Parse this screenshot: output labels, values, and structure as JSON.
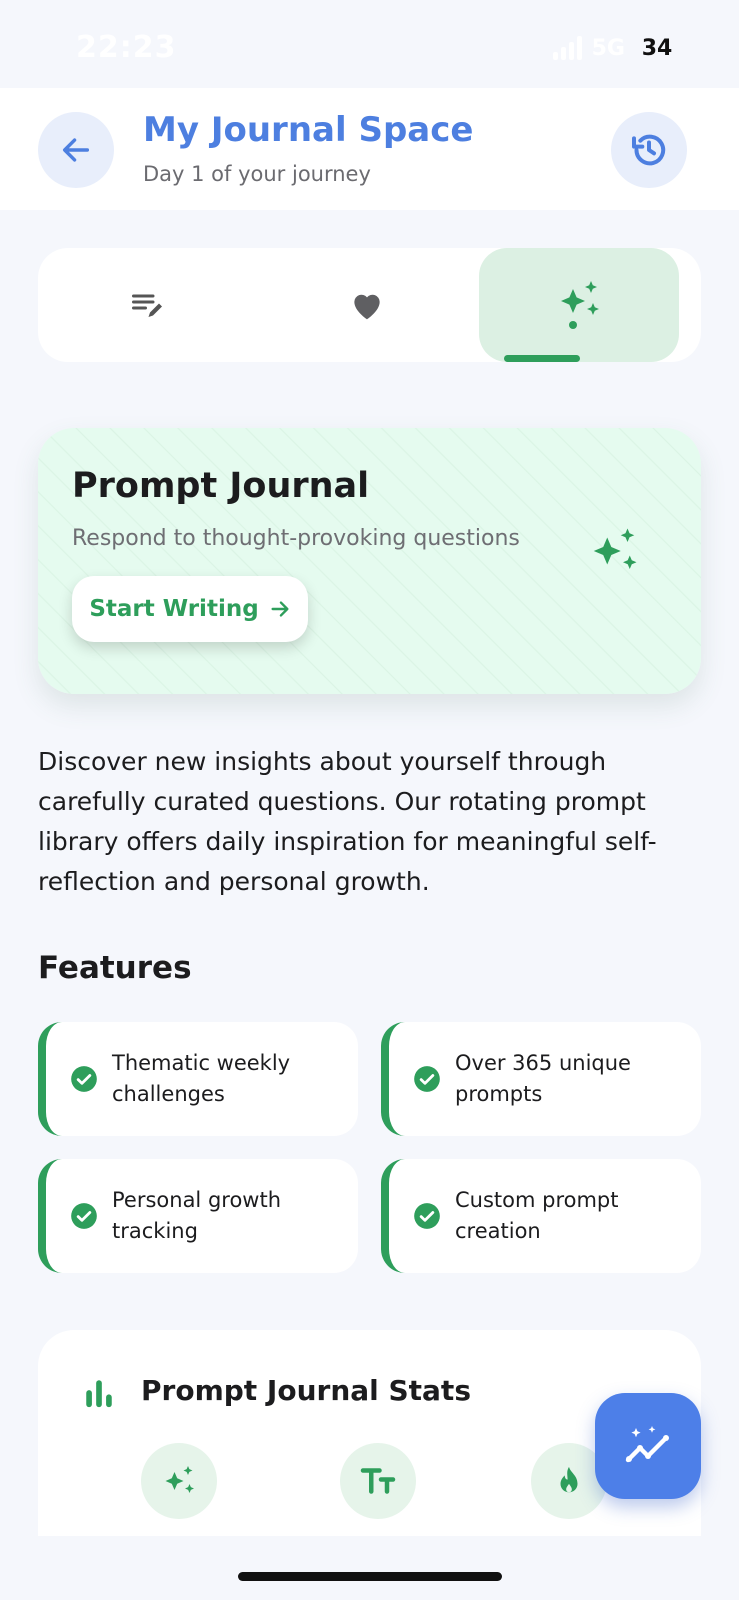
{
  "status_bar": {
    "time": "22:23",
    "network": "5G",
    "battery": "34"
  },
  "header": {
    "title": "My Journal Space",
    "subtitle": "Day 1 of your journey"
  },
  "tabs": [
    {
      "icon": "edit-list-icon",
      "active": false
    },
    {
      "icon": "heart-icon",
      "active": false
    },
    {
      "icon": "sparkles-icon",
      "active": true
    }
  ],
  "hero": {
    "title": "Prompt Journal",
    "subtitle": "Respond to thought-provoking questions",
    "button_label": "Start Writing"
  },
  "description": "Discover new insights about yourself through carefully curated questions. Our rotating prompt library offers daily inspiration for meaningful self-reflection and personal growth.",
  "features": {
    "title": "Features",
    "items": [
      "Thematic weekly challenges",
      "Over 365 unique prompts",
      "Personal growth tracking",
      "Custom prompt creation"
    ]
  },
  "stats": {
    "title": "Prompt Journal Stats"
  },
  "colors": {
    "accent_blue": "#4d7fe0",
    "accent_green": "#2e9e5b",
    "background": "#f5f7fc"
  }
}
